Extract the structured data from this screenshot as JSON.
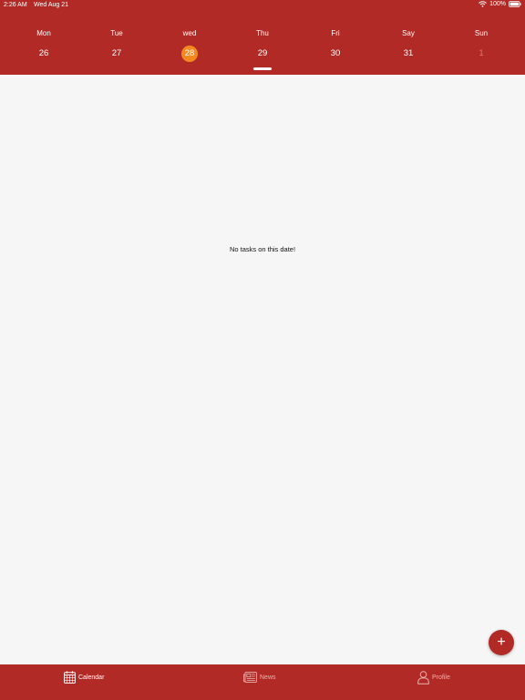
{
  "status_bar": {
    "time": "2:26 AM",
    "date": "Wed Aug 21",
    "battery": "100%",
    "wifi_icon": "wifi-icon",
    "battery_icon": "battery-icon"
  },
  "week": {
    "days": [
      {
        "name": "Mon",
        "number": "26",
        "selected": false
      },
      {
        "name": "Tue",
        "number": "27",
        "selected": false
      },
      {
        "name": "wed",
        "number": "28",
        "selected": true
      },
      {
        "name": "Thu",
        "number": "29",
        "selected": false
      },
      {
        "name": "Fri",
        "number": "30",
        "selected": false
      },
      {
        "name": "Say",
        "number": "31",
        "selected": false
      },
      {
        "name": "Sun",
        "number": "1",
        "selected": false
      }
    ]
  },
  "main": {
    "empty_message": "No tasks on this date!"
  },
  "fab": {
    "label": "+"
  },
  "tabs": [
    {
      "label": "Calendar",
      "icon": "calendar-icon",
      "active": true
    },
    {
      "label": "News",
      "icon": "newspaper-icon",
      "active": false
    },
    {
      "label": "Profile",
      "icon": "person-icon",
      "active": false
    }
  ],
  "colors": {
    "brand": "#b12a26",
    "selected_day": "#f48a1f",
    "background": "#f7f6f6"
  }
}
